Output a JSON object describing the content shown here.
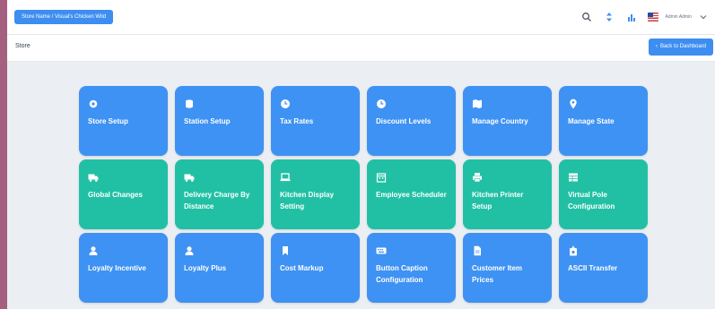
{
  "header": {
    "store_selector": "Store Name / Visual's Chicken Wild",
    "user_name": "Admin Admin",
    "colors": {
      "primary": "#3d8ef0",
      "tile_blue": "#3e92f3",
      "tile_teal": "#21c0a4"
    },
    "icons": [
      "search-icon",
      "sort-icon",
      "chart-icon",
      "us-flag-icon",
      "chevron-down-icon"
    ]
  },
  "subheader": {
    "title": "Store",
    "back_label": "Back to Dashboard"
  },
  "tiles": [
    {
      "label": "Store Setup",
      "icon": "gear-icon",
      "color": "blue"
    },
    {
      "label": "Station Setup",
      "icon": "database-icon",
      "color": "blue"
    },
    {
      "label": "Tax Rates",
      "icon": "clock-icon",
      "color": "blue"
    },
    {
      "label": "Discount Levels",
      "icon": "clock-icon",
      "color": "blue"
    },
    {
      "label": "Manage Country",
      "icon": "map-icon",
      "color": "blue"
    },
    {
      "label": "Manage State",
      "icon": "location-pin-icon",
      "color": "blue"
    },
    {
      "label": "Global Changes",
      "icon": "truck-icon",
      "color": "teal"
    },
    {
      "label": "Delivery Charge By Distance",
      "icon": "truck-icon",
      "color": "teal"
    },
    {
      "label": "Kitchen Display Setting",
      "icon": "laptop-icon",
      "color": "teal"
    },
    {
      "label": "Employee Scheduler",
      "icon": "calendar-icon",
      "color": "teal"
    },
    {
      "label": "Kitchen Printer Setup",
      "icon": "printer-icon",
      "color": "teal"
    },
    {
      "label": "Virtual Pole Configuration",
      "icon": "table-icon",
      "color": "teal"
    },
    {
      "label": "Loyalty Incentive",
      "icon": "user-icon",
      "color": "blue"
    },
    {
      "label": "Loyalty Plus",
      "icon": "user-icon",
      "color": "blue"
    },
    {
      "label": "Cost Markup",
      "icon": "bookmark-icon",
      "color": "blue"
    },
    {
      "label": "Button Caption Configuration",
      "icon": "keyboard-icon",
      "color": "blue"
    },
    {
      "label": "Customer Item Prices",
      "icon": "document-icon",
      "color": "blue"
    },
    {
      "label": "ASCII Transfer",
      "icon": "transfer-icon",
      "color": "blue"
    }
  ]
}
